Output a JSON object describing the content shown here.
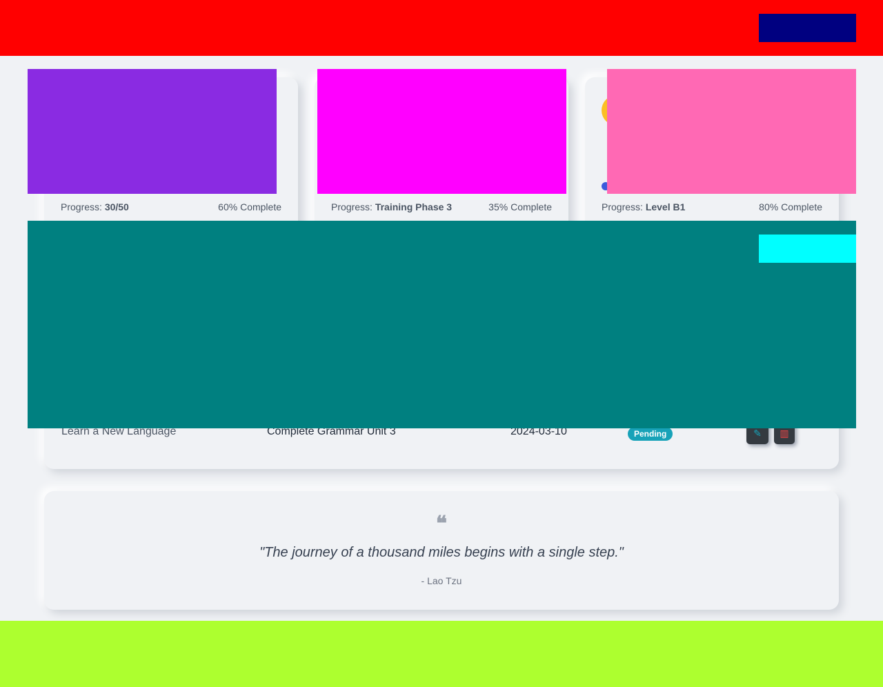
{
  "goals": [
    {
      "progress_label": "Progress:",
      "progress_value": "30/50",
      "percent_text": "60% Complete",
      "percent": 60
    },
    {
      "progress_label": "Progress:",
      "progress_value": "Training Phase 3",
      "percent_text": "35% Complete",
      "percent": 35
    },
    {
      "progress_label": "Progress:",
      "progress_value": "Level B1",
      "percent_text": "80% Complete",
      "percent": 80
    }
  ],
  "table": {
    "rows": [
      {
        "goal": "Learn a New Language",
        "milestone": "Complete Grammar Unit 3",
        "date": "2024-03-10",
        "status": "Pending"
      }
    ]
  },
  "quote": {
    "text": "\"The journey of a thousand miles begins with a single step.\"",
    "author": "- Lao Tzu"
  },
  "colors": {
    "header": "#ff0000",
    "header_button": "#000080",
    "footer": "#adff2f",
    "table_overlay": "#008080",
    "table_button": "#00ffff"
  }
}
